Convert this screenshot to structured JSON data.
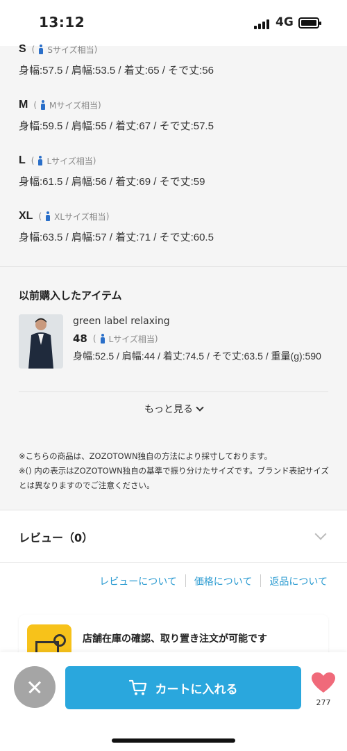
{
  "status": {
    "time": "13:12",
    "network": "4G"
  },
  "sizes": [
    {
      "name": "S",
      "tag": "Sサイズ相当",
      "measurements": "身幅:57.5 / 肩幅:53.5 / 着丈:65 / そで丈:56"
    },
    {
      "name": "M",
      "tag": "Mサイズ相当",
      "measurements": "身幅:59.5 / 肩幅:55 / 着丈:67 / そで丈:57.5"
    },
    {
      "name": "L",
      "tag": "Lサイズ相当",
      "measurements": "身幅:61.5 / 肩幅:56 / 着丈:69 / そで丈:59"
    },
    {
      "name": "XL",
      "tag": "XLサイズ相当",
      "measurements": "身幅:63.5 / 肩幅:57 / 着丈:71 / そで丈:60.5"
    }
  ],
  "previous": {
    "title": "以前購入したアイテム",
    "brand": "green label relaxing",
    "size": "48",
    "size_tag": "Lサイズ相当",
    "measurements": "身幅:52.5 / 肩幅:44 / 着丈:74.5 / そで丈:63.5 / 重量(g):590",
    "more_label": "もっと見る"
  },
  "notes": [
    "※こちらの商品は、ZOZOTOWN独自の方法により採寸しております。",
    "※() 内の表示はZOZOTOWN独自の基準で振り分けたサイズです。ブランド表記サイズとは異なりますのでご注意ください。"
  ],
  "review": {
    "label": "レビュー（0）"
  },
  "links": {
    "review": "レビューについて",
    "price": "価格について",
    "return": "返品について"
  },
  "store": {
    "text": "店舗在庫の確認、取り置き注文が可能です"
  },
  "bottom": {
    "cart_label": "カートに入れる",
    "like_count": "277"
  },
  "colors": {
    "accent": "#2aa7dd",
    "link": "#2b9bd1",
    "heart": "#f06a7a",
    "size_icon": "#2a6fc9"
  }
}
